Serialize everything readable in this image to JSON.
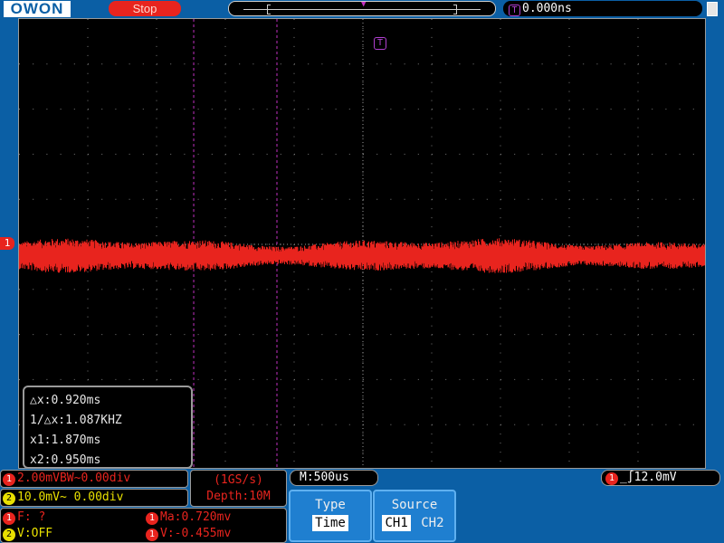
{
  "brand": "OWON",
  "status": "Stop",
  "trigger_time": "0.000ns",
  "trigger_icon": "T",
  "ch1_marker": "1",
  "cursor": {
    "dx": "△x:0.920ms",
    "freq": "1/△x:1.087KHZ",
    "x1": "x1:1.870ms",
    "x2": "x2:0.950ms"
  },
  "channels": {
    "ch1_num": "1",
    "ch1": "2.00mVBW~0.00div",
    "ch2_num": "2",
    "ch2": "10.0mV~  0.00div"
  },
  "acquisition": {
    "rate": "(1GS/s)",
    "depth": "Depth:10M"
  },
  "measure": {
    "f_num": "1",
    "f": "F:  ?",
    "v_num": "2",
    "v": "V:OFF",
    "ma_num": "1",
    "ma": "Ma:0.720mv",
    "vv_num": "1",
    "vv": "V:-0.455mv"
  },
  "timebase": "M:500us",
  "trigger": {
    "num": "1",
    "level": "12.0mV"
  },
  "softkeys": {
    "type_title": "Type",
    "type_value": "Time",
    "source_title": "Source",
    "source_opt1": "CH1",
    "source_opt2": "CH2"
  },
  "colors": {
    "ch1": "#e8241e",
    "ch2": "#e8e000",
    "cursor": "#c030c0",
    "panel_bg": "#0b5fa5"
  },
  "trace": {
    "level_fraction": 0.525,
    "noise_amplitude_fraction": 0.04,
    "cursor1_fraction": 0.254,
    "cursor2_fraction": 0.375
  }
}
